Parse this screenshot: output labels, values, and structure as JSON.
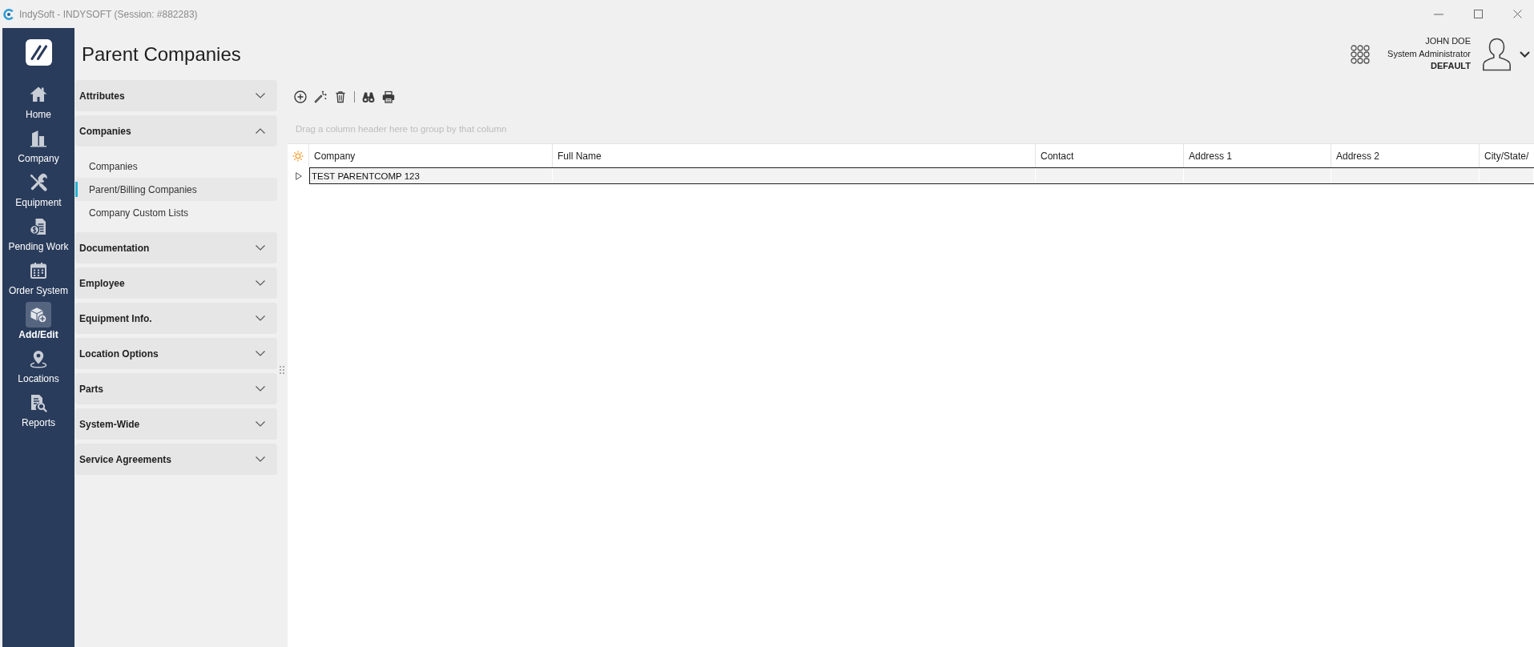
{
  "window": {
    "title": "IndySoft - INDYSOFT (Session: #882283)"
  },
  "nav": {
    "items": [
      {
        "label": "Home",
        "selected": false
      },
      {
        "label": "Company",
        "selected": false
      },
      {
        "label": "Equipment",
        "selected": false
      },
      {
        "label": "Pending Work",
        "selected": false
      },
      {
        "label": "Order System",
        "selected": false
      },
      {
        "label": "Add/Edit",
        "selected": true
      },
      {
        "label": "Locations",
        "selected": false
      },
      {
        "label": "Reports",
        "selected": false
      }
    ]
  },
  "page_title": "Parent Companies",
  "user": {
    "name": "JOHN DOE",
    "role": "System Administrator",
    "profile": "DEFAULT"
  },
  "sections": [
    {
      "label": "Attributes",
      "expanded": false
    },
    {
      "label": "Companies",
      "expanded": true,
      "items": [
        {
          "label": "Companies",
          "selected": false
        },
        {
          "label": "Parent/Billing Companies",
          "selected": true
        },
        {
          "label": "Company Custom Lists",
          "selected": false
        }
      ]
    },
    {
      "label": "Documentation",
      "expanded": false
    },
    {
      "label": "Employee",
      "expanded": false
    },
    {
      "label": "Equipment Info.",
      "expanded": false
    },
    {
      "label": "Location Options",
      "expanded": false
    },
    {
      "label": "Parts",
      "expanded": false
    },
    {
      "label": "System-Wide",
      "expanded": false
    },
    {
      "label": "Service Agreements",
      "expanded": false
    }
  ],
  "grid": {
    "group_panel_hint": "Drag a column header here to group by that column",
    "columns": [
      "Company",
      "Full Name",
      "Contact",
      "Address 1",
      "Address 2",
      "City/State/"
    ],
    "rows": [
      {
        "cells": [
          "TEST PARENTCOMP 123"
        ],
        "selected": true,
        "expanded": false
      }
    ]
  }
}
